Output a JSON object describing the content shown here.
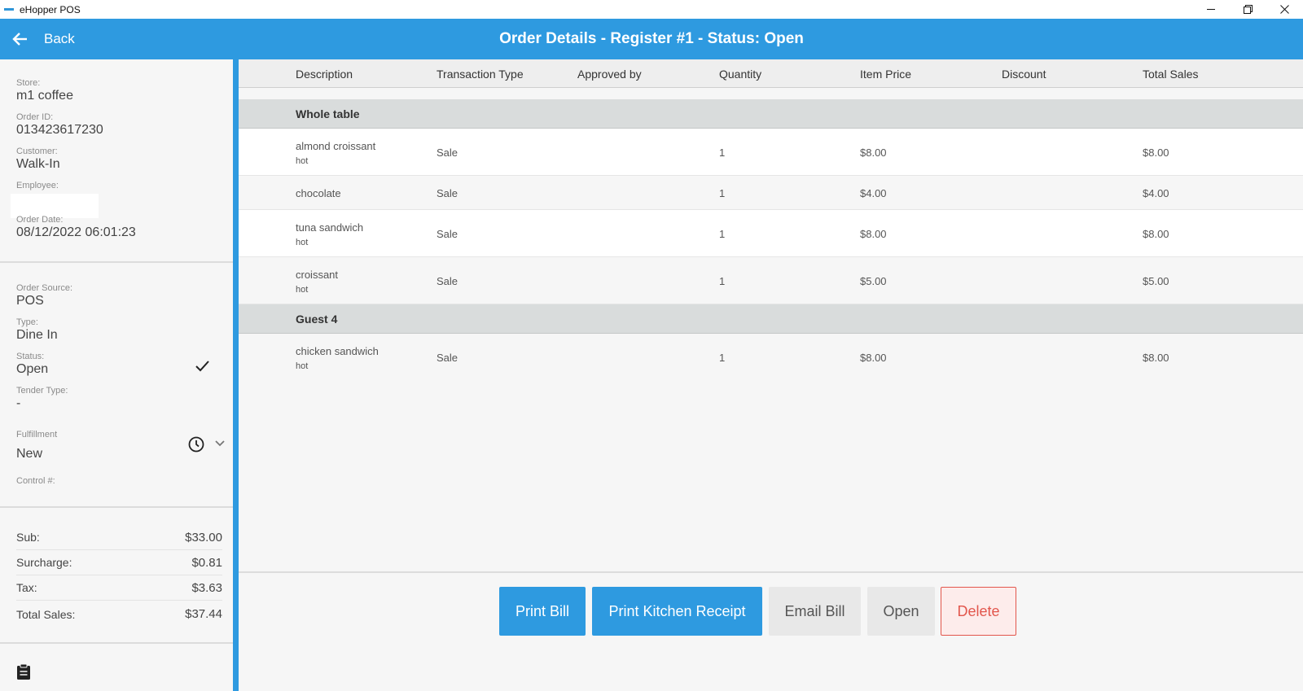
{
  "window": {
    "title": "eHopper POS",
    "minimize_icon": "minimize-icon",
    "restore_icon": "restore-icon",
    "close_icon": "close-icon"
  },
  "header": {
    "back_label": "Back",
    "title": "Order Details - Register #1 - Status: Open",
    "color": "#2e9ae0"
  },
  "order_info": {
    "store_label": "Store:",
    "store": "m1 coffee",
    "order_id_label": "Order ID:",
    "order_id": "013423617230",
    "customer_label": "Customer:",
    "customer": "Walk-In",
    "employee_label": "Employee:",
    "order_date_label": "Order Date:",
    "order_date": "08/12/2022 06:01:23",
    "source_label": "Order Source:",
    "source": "POS",
    "type_label": "Type:",
    "type": "Dine In",
    "status_label": "Status:",
    "status": "Open",
    "tender_label": "Tender Type:",
    "tender": "-",
    "fulfillment_label": "Fulfillment",
    "fulfillment": "New",
    "control_label": "Control #:"
  },
  "totals": {
    "sub_label": "Sub:",
    "sub": "$33.00",
    "surcharge_label": "Surcharge:",
    "surcharge": "$0.81",
    "tax_label": "Tax:",
    "tax": "$3.63",
    "total_label": "Total Sales:",
    "total": "$37.44"
  },
  "table": {
    "columns": [
      "Description",
      "Transaction Type",
      "Approved by",
      "Quantity",
      "Item Price",
      "Discount",
      "Total Sales"
    ],
    "groups": [
      {
        "name": "Whole table",
        "items": [
          {
            "description": "almond croissant",
            "modifier": "hot",
            "type": "Sale",
            "approved_by": "",
            "quantity": "1",
            "price": "$8.00",
            "discount": "",
            "total": "$8.00"
          },
          {
            "description": "chocolate",
            "modifier": "",
            "type": "Sale",
            "approved_by": "",
            "quantity": "1",
            "price": "$4.00",
            "discount": "",
            "total": "$4.00"
          },
          {
            "description": "tuna sandwich",
            "modifier": "hot",
            "type": "Sale",
            "approved_by": "",
            "quantity": "1",
            "price": "$8.00",
            "discount": "",
            "total": "$8.00"
          },
          {
            "description": "croissant",
            "modifier": "hot",
            "type": "Sale",
            "approved_by": "",
            "quantity": "1",
            "price": "$5.00",
            "discount": "",
            "total": "$5.00"
          }
        ]
      },
      {
        "name": "Guest 4",
        "items": [
          {
            "description": "chicken sandwich",
            "modifier": "hot",
            "type": "Sale",
            "approved_by": "",
            "quantity": "1",
            "price": "$8.00",
            "discount": "",
            "total": "$8.00"
          }
        ]
      }
    ]
  },
  "buttons": {
    "print_bill": "Print Bill",
    "print_kitchen": "Print Kitchen Receipt",
    "email_bill": "Email Bill",
    "open": "Open",
    "delete": "Delete"
  }
}
